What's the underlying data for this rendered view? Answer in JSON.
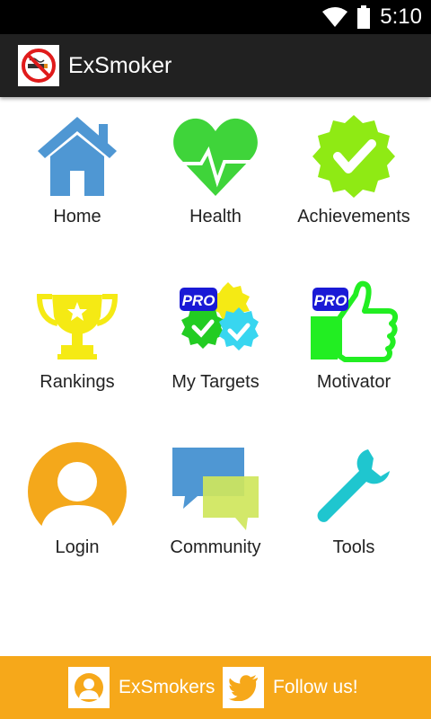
{
  "status_bar": {
    "time": "5:10"
  },
  "app_bar": {
    "title": "ExSmoker"
  },
  "tiles": [
    {
      "label": "Home"
    },
    {
      "label": "Health"
    },
    {
      "label": "Achievements"
    },
    {
      "label": "Rankings"
    },
    {
      "label": "My Targets",
      "badge": "PRO"
    },
    {
      "label": "Motivator",
      "badge": "PRO"
    },
    {
      "label": "Login"
    },
    {
      "label": "Community"
    },
    {
      "label": "Tools"
    }
  ],
  "footer": {
    "exsmokers_label": "ExSmokers",
    "follow_label": "Follow us!"
  },
  "colors": {
    "footer_bg": "#f6a81a",
    "home_blue": "#4f97d3",
    "health_green": "#3fd43a",
    "achievement_green": "#8fea14",
    "trophy_yellow": "#f5ea14",
    "pro_blue": "#1a1ad6",
    "motivator_green": "#22ee22",
    "login_orange": "#f4a81b",
    "community_blue": "#4f97d3",
    "community_green": "#cfe65c",
    "tools_teal": "#1fc6cf",
    "twitter_orange": "#f6a81a"
  }
}
